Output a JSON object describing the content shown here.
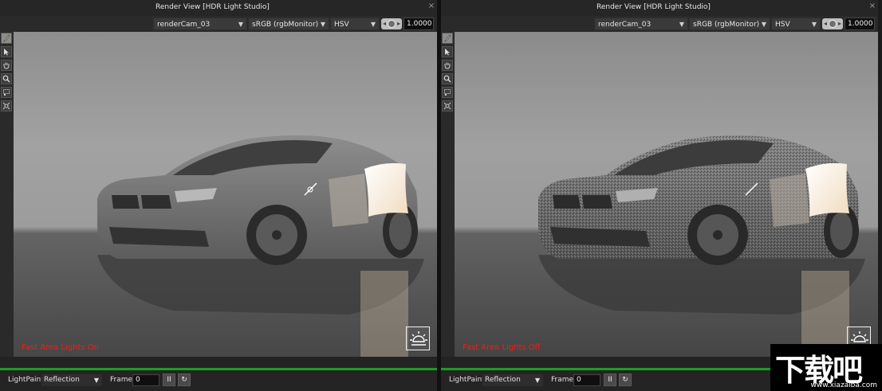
{
  "left_panel": {
    "window_title": "Render View [HDR Light Studio]",
    "close_label": "×",
    "camera": "renderCam_03",
    "color_space": "sRGB (rgbMonitor)",
    "color_mode": "HSV",
    "exposure_value": "1.0000",
    "caption": "Fast Area Lights On",
    "status": {
      "lightpaint_label": "LightPaint",
      "lightpaint_mode": "Reflection",
      "frame_label": "Frame",
      "frame_value": "0",
      "pause_label": "II",
      "refresh_label": "↻"
    }
  },
  "right_panel": {
    "window_title": "Render View [HDR Light Studio]",
    "close_label": "×",
    "camera": "renderCam_03",
    "color_space": "sRGB (rgbMonitor)",
    "color_mode": "HSV",
    "exposure_value": "1.0000",
    "caption": "Fast Area Lights Off",
    "status": {
      "lightpaint_label": "LightPaint",
      "lightpaint_mode": "Reflection",
      "frame_label": "Frame",
      "frame_value": "0",
      "pause_label": "II",
      "refresh_label": "↻"
    }
  },
  "toolbar_icons": [
    "paint-brush-icon",
    "pointer-arrow-icon",
    "pan-hand-icon",
    "zoom-magnifier-icon",
    "region-select-icon",
    "zoom-fit-icon"
  ],
  "colors": {
    "caption": "#e8201a",
    "progress": "#1f9a2a",
    "light_panel": "#f6e6cf"
  },
  "watermark": {
    "logo": "下载吧",
    "url": "www.xiazaiba.com"
  }
}
